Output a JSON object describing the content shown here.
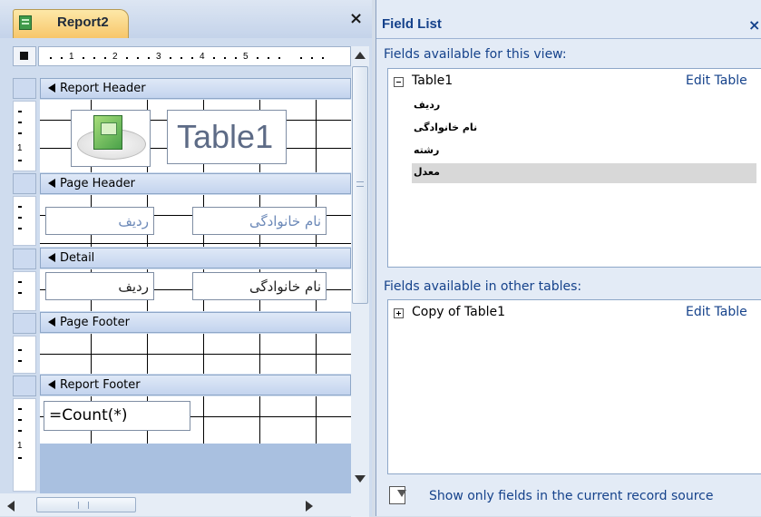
{
  "designer": {
    "tab_label": "Report2",
    "close_glyph": "×",
    "ruler_ticks": [
      "1",
      "2",
      "3",
      "4",
      "5"
    ],
    "vruler_numbers": [
      "1",
      "1"
    ],
    "sections": {
      "report_header": "Report Header",
      "page_header": "Page Header",
      "detail": "Detail",
      "page_footer": "Page Footer",
      "report_footer": "Report Footer"
    },
    "title_control": "Table1",
    "page_header_controls": {
      "radif": "ردیف",
      "nam": "نام خانوادگی"
    },
    "detail_controls": {
      "radif": "ردیف",
      "nam": "نام خانوادگی"
    },
    "footer_control": "=Count(*)"
  },
  "field_list": {
    "title": "Field List",
    "close_glyph": "×",
    "this_view_label": "Fields available for this view:",
    "other_tables_label": "Fields available in other tables:",
    "table1": {
      "name": "Table1",
      "edit_label": "Edit Table",
      "fields": [
        "ردیف",
        "نام خانوادگی",
        "رشته",
        "معدل"
      ],
      "selected_field": "معدل"
    },
    "copy_table": {
      "name": "Copy of Table1",
      "edit_label": "Edit Table"
    },
    "footer_text": "Show only fields in the current record source"
  },
  "colors": {
    "accent": "#15428b",
    "tab_active": "#f7c66a",
    "band": "#c3d4ee"
  }
}
